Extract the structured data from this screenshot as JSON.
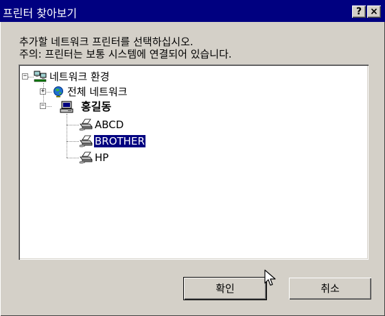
{
  "window": {
    "title": "프린터 찾아보기",
    "help_glyph": "?",
    "close_glyph": "×"
  },
  "instructions": {
    "line1": "추가할 네트워크 프린터를 선택하십시오.",
    "line2": "주의: 프린터는 보통 시스템에 연결되어 있습니다."
  },
  "tree": {
    "root": {
      "label": "네트워크 환경",
      "icon": "network-neighborhood-icon",
      "expanded": true
    },
    "entire_network": {
      "label": "전체 네트워크",
      "icon": "globe-icon",
      "expanded": false
    },
    "computer": {
      "label": "홍길동",
      "icon": "computer-icon",
      "expanded": true
    },
    "printers": [
      {
        "label": "ABCD",
        "icon": "printer-icon",
        "selected": false
      },
      {
        "label": "BROTHER",
        "icon": "printer-icon",
        "selected": true
      },
      {
        "label": "HP",
        "icon": "printer-icon",
        "selected": false
      }
    ]
  },
  "buttons": {
    "ok_label": "확인",
    "cancel_label": "취소"
  },
  "colors": {
    "title_bar": "#000080",
    "selection": "#000080",
    "dialog_face": "#d4d0c8"
  }
}
